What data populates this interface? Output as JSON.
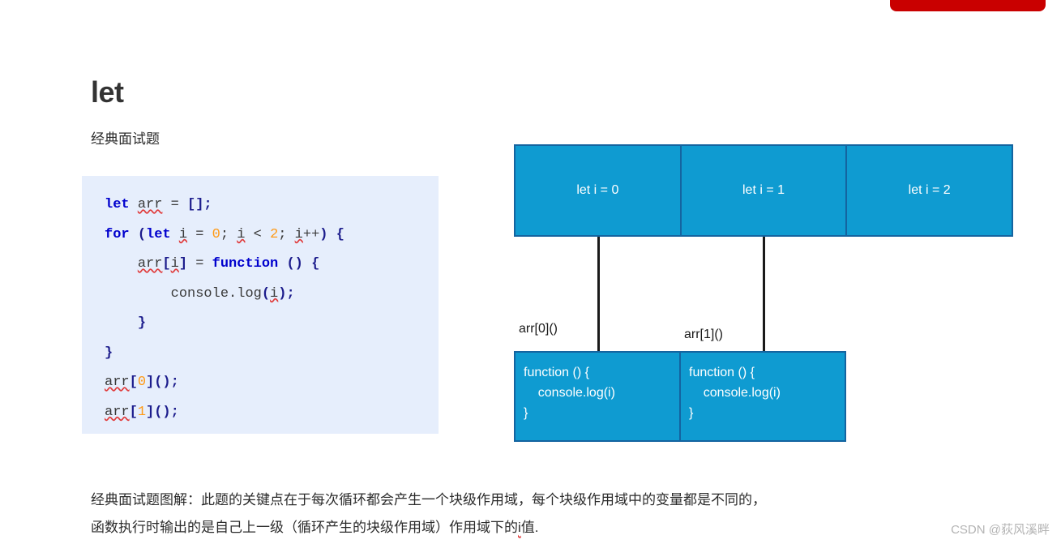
{
  "banner": {
    "shape": "red-rounded-bar",
    "color": "#c90000"
  },
  "page": {
    "title": "let",
    "subtitle": "经典面试题"
  },
  "code_block": {
    "background": "#e6eefc",
    "language": "javascript",
    "lines": [
      "let arr = [];",
      "for (let i = 0; i < 2; i++) {",
      "    arr[i] = function () {",
      "        console.log(i);",
      "    }",
      "}",
      "arr[0]();",
      "arr[1]();"
    ],
    "tokens": {
      "kw_let": "let",
      "kw_for": "for",
      "kw_function": "function",
      "ident_arr": "arr",
      "ident_i": "i",
      "num_0": "0",
      "num_1": "1",
      "num_2": "2",
      "call_console_log": "console.log"
    }
  },
  "diagram": {
    "box_fill": "#0f9bd1",
    "box_border": "#1464a0",
    "connector_color": "#1a1a1a",
    "scopes": [
      {
        "label": "let i = 0"
      },
      {
        "label": "let i = 1"
      },
      {
        "label": "let i = 2"
      }
    ],
    "call_labels": [
      {
        "label": "arr[0]()"
      },
      {
        "label": "arr[1]()"
      }
    ],
    "functions": [
      {
        "line1": "function () {",
        "line2": "    console.log(i)",
        "line3": "}"
      },
      {
        "line1": "function () {",
        "line2": "    console.log(i)",
        "line3": "}"
      }
    ]
  },
  "footer": {
    "line1": "经典面试题图解：此题的关键点在于每次循环都会产生一个块级作用域，每个块级作用域中的变量都是不同的，",
    "line2_before": "函数执行时输出的是自己上一级（循环产生的块级作用域）作用域下的",
    "line2_i": "i",
    "line2_after": "值."
  },
  "watermark": {
    "text": "CSDN @荻风溪畔"
  }
}
